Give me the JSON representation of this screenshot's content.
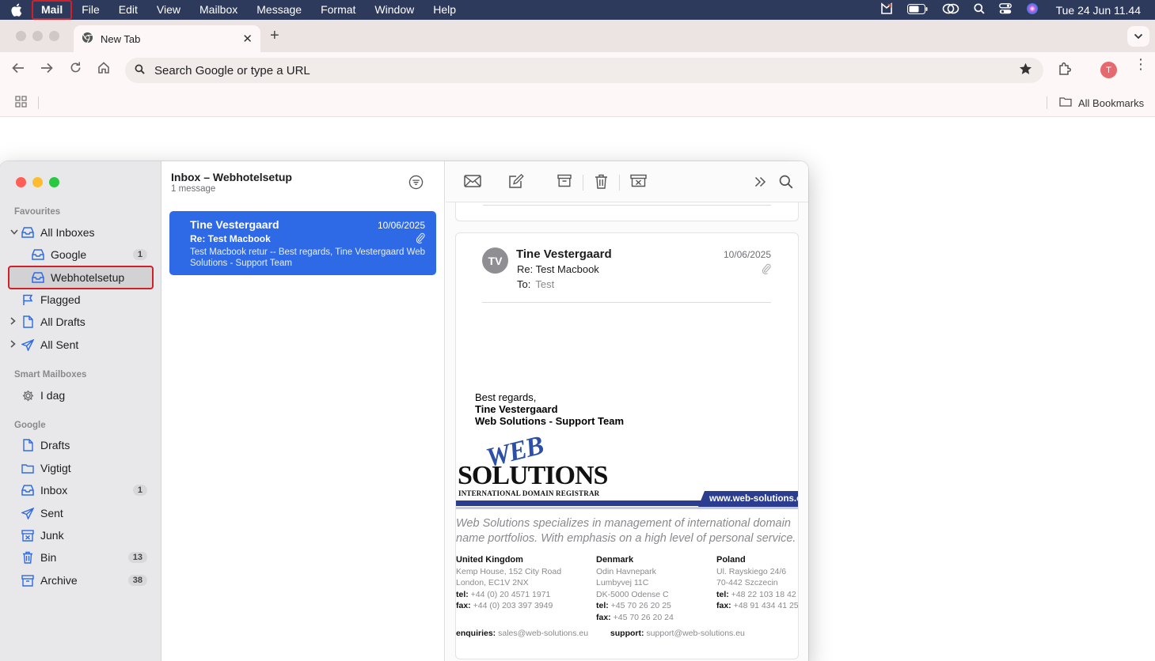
{
  "menubar": {
    "app": "Mail",
    "items": [
      "File",
      "Edit",
      "View",
      "Mailbox",
      "Message",
      "Format",
      "Window",
      "Help"
    ],
    "clock": "Tue 24 Jun  11.44"
  },
  "browser": {
    "tab_title": "New Tab",
    "omnibox_placeholder": "Search Google or type a URL",
    "profile_initial": "T",
    "all_bookmarks": "All Bookmarks"
  },
  "sidebar": {
    "favourites_header": "Favourites",
    "all_inboxes": "All Inboxes",
    "google_inbox": "Google",
    "google_inbox_count": "1",
    "webhotel": "Webhotelsetup",
    "flagged": "Flagged",
    "all_drafts": "All Drafts",
    "all_sent": "All Sent",
    "smart_header": "Smart Mailboxes",
    "i_dag": "I dag",
    "google_header": "Google",
    "drafts": "Drafts",
    "vigtigt": "Vigtigt",
    "inbox": "Inbox",
    "inbox_count": "1",
    "sent": "Sent",
    "junk": "Junk",
    "bin": "Bin",
    "bin_count": "13",
    "archive": "Archive",
    "archive_count": "38"
  },
  "list": {
    "title": "Inbox – Webhotelsetup",
    "count": "1 message",
    "message": {
      "from": "Tine Vestergaard",
      "date": "10/06/2025",
      "subject": "Re: Test Macbook",
      "preview": "Test Macbook retur -- Best regards, Tine Vestergaard Web Solutions - Support Team"
    }
  },
  "reader": {
    "avatar": "TV",
    "from": "Tine Vestergaard",
    "date": "10/06/2025",
    "subject": "Re: Test Macbook",
    "to_label": "To:",
    "to_value": "Test",
    "sig_line1": "Best regards,",
    "sig_line2": "Tine Vestergaard",
    "sig_line3": "Web Solutions - Support Team",
    "logo_web": "WEB",
    "logo_solutions": "SOLUTIONS",
    "logo_sub": "INTERNATIONAL DOMAIN REGISTRAR",
    "logo_url": "www.web-solutions.eu",
    "tagline1": "Web Solutions specializes in management of international domain",
    "tagline2": "name portfolios. With emphasis on a high level of personal service.",
    "uk_title": "United Kingdom",
    "uk_addr1": "Kemp House, 152 City Road",
    "uk_addr2": "London, EC1V 2NX",
    "uk_tel_label": "tel:",
    "uk_tel": "+44 (0) 20 4571 1971",
    "uk_fax_label": "fax:",
    "uk_fax": "+44 (0) 203 397 3949",
    "dk_title": "Denmark",
    "dk_addr1": "Odin Havnepark",
    "dk_addr2": "Lumbyvej 11C",
    "dk_addr3": "DK-5000 Odense C",
    "dk_tel_label": "tel:",
    "dk_tel": "+45 70 26 20 25",
    "dk_fax_label": "fax:",
    "dk_fax": "+45 70 26 20 24",
    "pl_title": "Poland",
    "pl_addr1": "Ul. Rayskiego 24/6",
    "pl_addr2": "70-442 Szczecin",
    "pl_tel_label": "tel:",
    "pl_tel": "+48 22 103 18 42",
    "pl_fax_label": "fax:",
    "pl_fax": "+48 91 434 41 25",
    "enq_label": "enquiries:",
    "enq": "sales@web-solutions.eu",
    "sup_label": "support:",
    "sup": "support@web-solutions.eu"
  },
  "colors": {
    "menubar": "#2d3a5c",
    "selection": "#2e6ae6",
    "highlight_border": "#d0202a",
    "logo_blue": "#2a3d8f"
  }
}
